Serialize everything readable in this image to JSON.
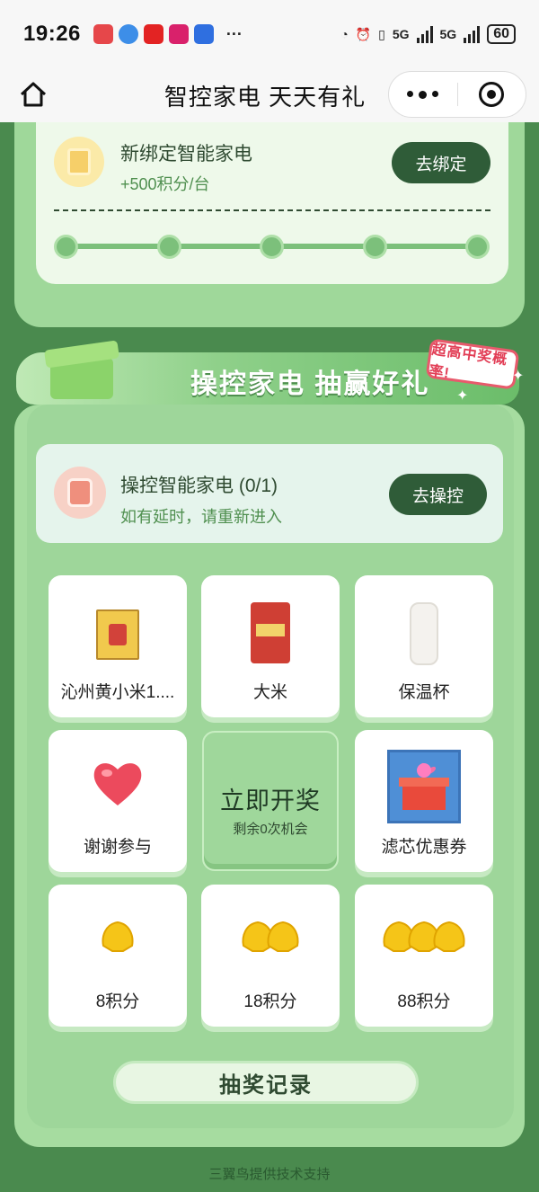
{
  "status_bar": {
    "time": "19:26",
    "more": "···",
    "battery": "60",
    "network_1": "5G",
    "network_2": "5G"
  },
  "nav": {
    "title": "智控家电 天天有礼"
  },
  "bind_task": {
    "title": "新绑定智能家电",
    "reward": "+500积分/台",
    "button": "去绑定",
    "progress_nodes": 5
  },
  "banner": {
    "title": "操控家电 抽赢好礼",
    "badge": "超高中奖概率!"
  },
  "control_task": {
    "title": "操控智能家电 (0/1)",
    "subtitle": "如有延时，请重新进入",
    "button": "去操控"
  },
  "prizes": [
    {
      "label": "沁州黄小米1....",
      "icon": "millet-bag-icon"
    },
    {
      "label": "大米",
      "icon": "rice-bag-icon"
    },
    {
      "label": "保温杯",
      "icon": "thermos-cup-icon"
    },
    {
      "label": "谢谢参与",
      "icon": "heart-icon"
    },
    {
      "label": "滤芯优惠券",
      "icon": "gift-coupon-icon"
    },
    {
      "label": "8积分",
      "icon": "one-shell-icon"
    },
    {
      "label": "18积分",
      "icon": "two-shells-icon"
    },
    {
      "label": "88积分",
      "icon": "three-shells-icon"
    }
  ],
  "draw": {
    "title": "立即开奖",
    "remaining": "剩余0次机会"
  },
  "record_button": "抽奖记录",
  "footer": "三翼鸟提供技术支持",
  "colors": {
    "primary_button": "#2f5c38",
    "page_bg": "#4a8a4e",
    "card_bg": "#9fd89a"
  }
}
